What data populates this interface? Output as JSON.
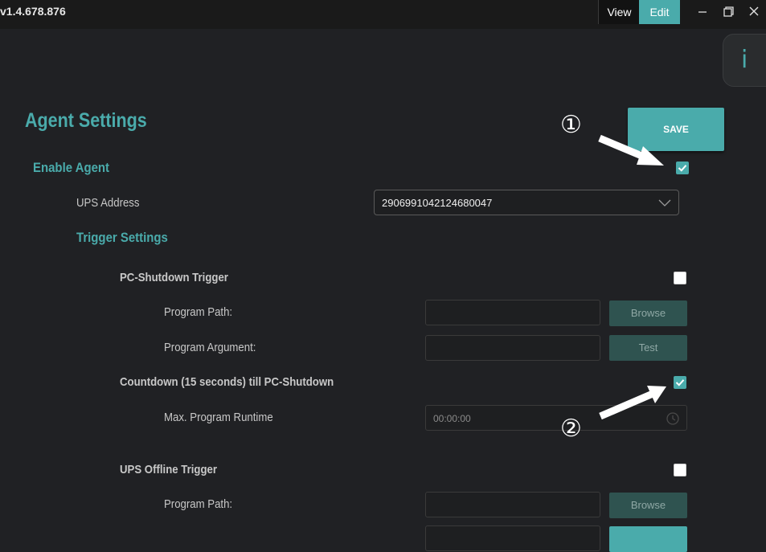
{
  "titlebar": {
    "version": "v1.4.678.876",
    "view_label": "View",
    "edit_label": "Edit"
  },
  "info_tab": {
    "label": "i"
  },
  "page": {
    "title": "Agent Settings",
    "save_label": "SAVE"
  },
  "agent": {
    "enable_label": "Enable Agent",
    "enabled": true
  },
  "ups": {
    "address_label": "UPS Address",
    "address_value": "2906991042124680047"
  },
  "trigger": {
    "section_label": "Trigger Settings"
  },
  "pc_shutdown": {
    "label": "PC-Shutdown Trigger",
    "checked": false,
    "program_path_label": "Program Path:",
    "program_argument_label": "Program Argument:",
    "browse_label": "Browse",
    "test_label": "Test"
  },
  "countdown": {
    "label": "Countdown (15 seconds) till PC-Shutdown",
    "checked": true,
    "max_runtime_label": "Max. Program Runtime",
    "max_runtime_value": "00:00:00"
  },
  "ups_offline": {
    "label": "UPS Offline Trigger",
    "checked": false,
    "program_path_label": "Program Path:",
    "browse_label": "Browse"
  },
  "callouts": {
    "one": "①",
    "two": "②"
  },
  "colors": {
    "accent": "#4aabab",
    "background": "#202124",
    "titlebar": "#1a1a1a"
  },
  "icons": [
    "minimize-icon",
    "restore-icon",
    "close-icon",
    "chevron-down-icon",
    "check-icon",
    "clock-icon",
    "arrow-icon"
  ]
}
